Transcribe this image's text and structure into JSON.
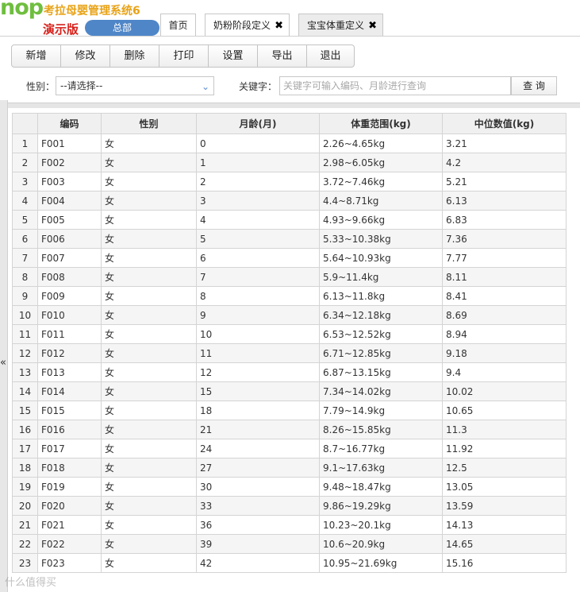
{
  "header": {
    "logo_text": "nop",
    "app_title": "考拉母婴管理系统6",
    "demo_label": "演示版",
    "hq_button": "总部"
  },
  "tabs": [
    {
      "label": "首页"
    },
    {
      "label": "奶粉阶段定义",
      "close": "✖"
    },
    {
      "label": "宝宝体重定义",
      "close": "✖",
      "active": true
    }
  ],
  "toolbar": {
    "buttons": [
      "新增",
      "修改",
      "删除",
      "打印",
      "设置",
      "导出",
      "退出"
    ]
  },
  "filter": {
    "gender_label": "性别：",
    "gender_value": "--请选择--",
    "keyword_label": "关键字：",
    "keyword_placeholder": "关键字可输入编码、月龄进行查询",
    "query_button": "查 询"
  },
  "grid": {
    "columns": [
      "",
      "编码",
      "性别",
      "月龄(月)",
      "体重范围(kg)",
      "中位数值(kg)"
    ],
    "rows": [
      [
        "1",
        "F001",
        "女",
        "0",
        "2.26~4.65kg",
        "3.21"
      ],
      [
        "2",
        "F002",
        "女",
        "1",
        "2.98~6.05kg",
        "4.2"
      ],
      [
        "3",
        "F003",
        "女",
        "2",
        "3.72~7.46kg",
        "5.21"
      ],
      [
        "4",
        "F004",
        "女",
        "3",
        "4.4~8.71kg",
        "6.13"
      ],
      [
        "5",
        "F005",
        "女",
        "4",
        "4.93~9.66kg",
        "6.83"
      ],
      [
        "6",
        "F006",
        "女",
        "5",
        "5.33~10.38kg",
        "7.36"
      ],
      [
        "7",
        "F007",
        "女",
        "6",
        "5.64~10.93kg",
        "7.77"
      ],
      [
        "8",
        "F008",
        "女",
        "7",
        "5.9~11.4kg",
        "8.11"
      ],
      [
        "9",
        "F009",
        "女",
        "8",
        "6.13~11.8kg",
        "8.41"
      ],
      [
        "10",
        "F010",
        "女",
        "9",
        "6.34~12.18kg",
        "8.69"
      ],
      [
        "11",
        "F011",
        "女",
        "10",
        "6.53~12.52kg",
        "8.94"
      ],
      [
        "12",
        "F012",
        "女",
        "11",
        "6.71~12.85kg",
        "9.18"
      ],
      [
        "13",
        "F013",
        "女",
        "12",
        "6.87~13.15kg",
        "9.4"
      ],
      [
        "14",
        "F014",
        "女",
        "15",
        "7.34~14.02kg",
        "10.02"
      ],
      [
        "15",
        "F015",
        "女",
        "18",
        "7.79~14.9kg",
        "10.65"
      ],
      [
        "16",
        "F016",
        "女",
        "21",
        "8.26~15.85kg",
        "11.3"
      ],
      [
        "17",
        "F017",
        "女",
        "24",
        "8.7~16.77kg",
        "11.92"
      ],
      [
        "18",
        "F018",
        "女",
        "27",
        "9.1~17.63kg",
        "12.5"
      ],
      [
        "19",
        "F019",
        "女",
        "30",
        "9.48~18.47kg",
        "13.05"
      ],
      [
        "20",
        "F020",
        "女",
        "33",
        "9.86~19.29kg",
        "13.59"
      ],
      [
        "21",
        "F021",
        "女",
        "36",
        "10.23~20.1kg",
        "14.13"
      ],
      [
        "22",
        "F022",
        "女",
        "39",
        "10.6~20.9kg",
        "14.65"
      ],
      [
        "23",
        "F023",
        "女",
        "42",
        "10.95~21.69kg",
        "15.16"
      ]
    ]
  },
  "sidebar": {
    "collapse_icon": "«"
  },
  "watermark": "什么值得买"
}
